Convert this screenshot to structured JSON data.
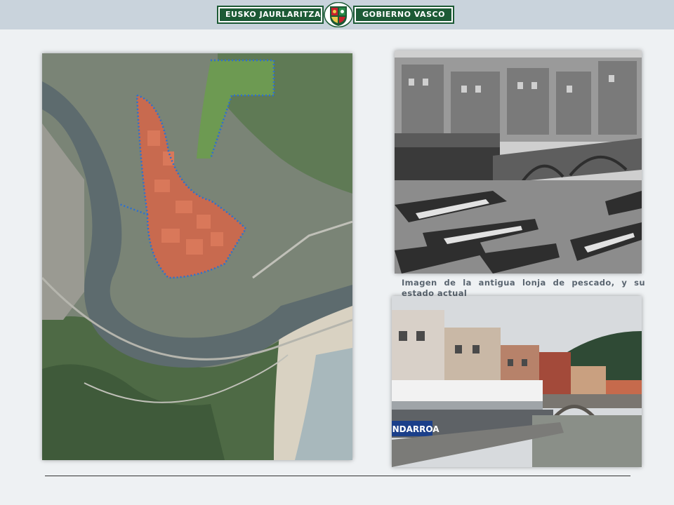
{
  "header": {
    "logo_left_text": "EUSKO JAURLARITZA",
    "logo_right_text": "GOBIERNO VASCO",
    "logo_colors": {
      "green": "#1c5a35",
      "red": "#c8202c"
    }
  },
  "figures": {
    "old_photo": {
      "title": "Antigua lonja de pescado"
    },
    "caption": "Imagen de la antigua lonja de pescado, y su estado actual",
    "current_photo": {
      "sign_text": "ONDARROA"
    }
  }
}
